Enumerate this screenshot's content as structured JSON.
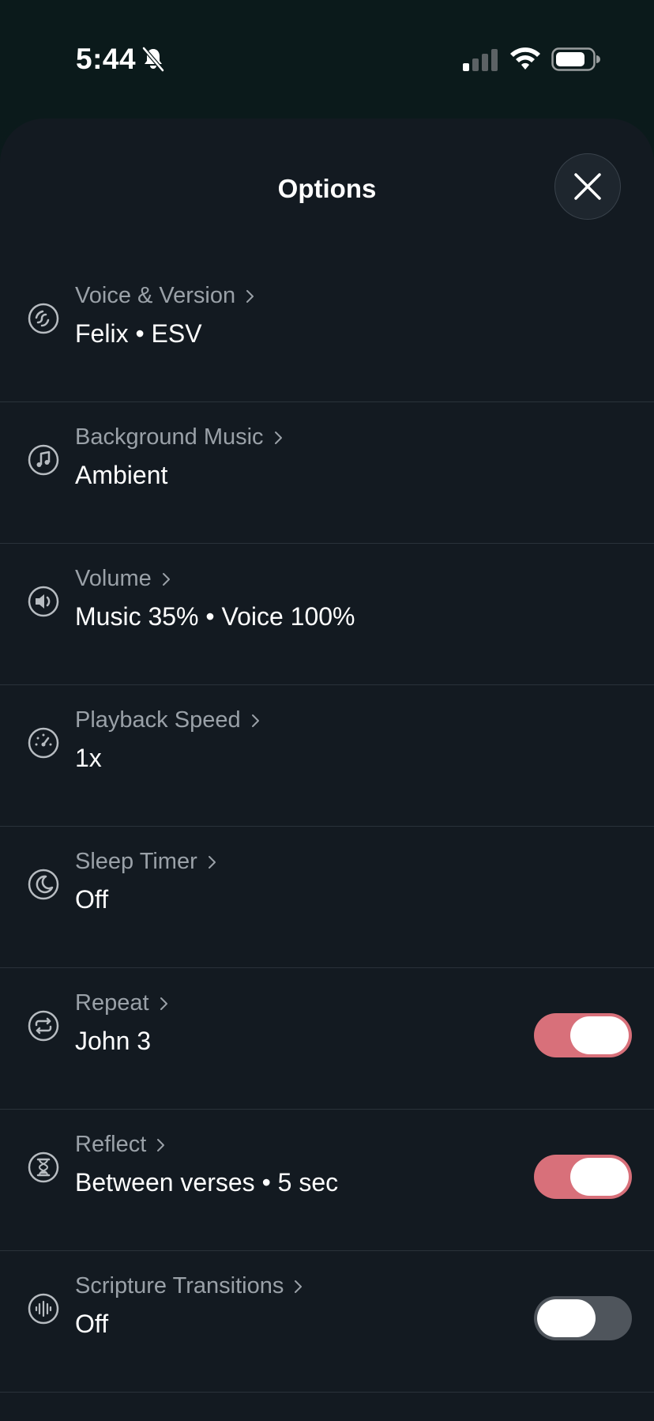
{
  "status_bar": {
    "time": "5:44",
    "icons": [
      "bell-slash-icon",
      "cellular-signal-icon",
      "wifi-icon",
      "battery-icon"
    ]
  },
  "sheet": {
    "title": "Options",
    "close_icon": "close-icon"
  },
  "rows": [
    {
      "label": "Voice & Version",
      "value": "Felix • ESV",
      "icon": "voice-icon",
      "toggle": null
    },
    {
      "label": "Background Music",
      "value": "Ambient",
      "icon": "music-note-icon",
      "toggle": null
    },
    {
      "label": "Volume",
      "value": "Music 35% • Voice 100%",
      "icon": "speaker-icon",
      "toggle": null
    },
    {
      "label": "Playback Speed",
      "value": "1x",
      "icon": "speedometer-icon",
      "toggle": null
    },
    {
      "label": "Sleep Timer",
      "value": "Off",
      "icon": "moon-icon",
      "toggle": null
    },
    {
      "label": "Repeat",
      "value": "John 3",
      "icon": "repeat-icon",
      "toggle": true
    },
    {
      "label": "Reflect",
      "value": "Between verses • 5 sec",
      "icon": "hourglass-icon",
      "toggle": true
    },
    {
      "label": "Scripture Transitions",
      "value": "Off",
      "icon": "waveform-icon",
      "toggle": false
    }
  ],
  "colors": {
    "accent": "#d8707a",
    "sheet_bg": "#131a21",
    "toggle_off": "#4f555c",
    "label": "#9aa1a8",
    "value": "#ffffff"
  }
}
